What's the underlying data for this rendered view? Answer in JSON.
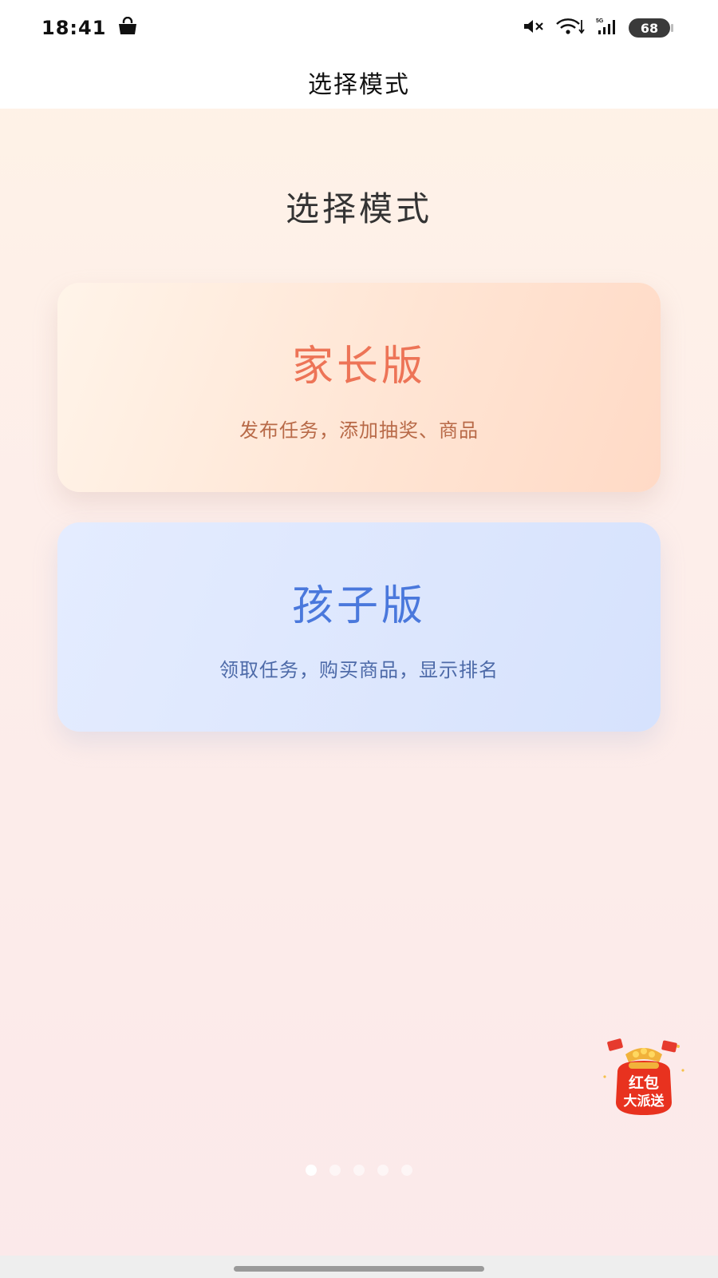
{
  "status_bar": {
    "time": "18:41",
    "battery": "68",
    "network": "5G",
    "icons": [
      "shopping-bag-icon",
      "mute-icon",
      "wifi-icon",
      "cellular-signal-icon",
      "battery-icon"
    ]
  },
  "nav": {
    "title": "选择模式"
  },
  "page": {
    "heading": "选择模式"
  },
  "modes": [
    {
      "title": "家长版",
      "description": "发布任务，添加抽奖、商品",
      "title_color": "#ed7457",
      "background": "#ffe5d4"
    },
    {
      "title": "孩子版",
      "description": "领取任务，购买商品，显示排名",
      "title_color": "#4a78dc",
      "background": "#dce6fd"
    }
  ],
  "promo": {
    "line1": "红包",
    "line2": "大派送",
    "icon": "red-envelope-icon"
  },
  "pager": {
    "total": 5,
    "active": 1
  }
}
